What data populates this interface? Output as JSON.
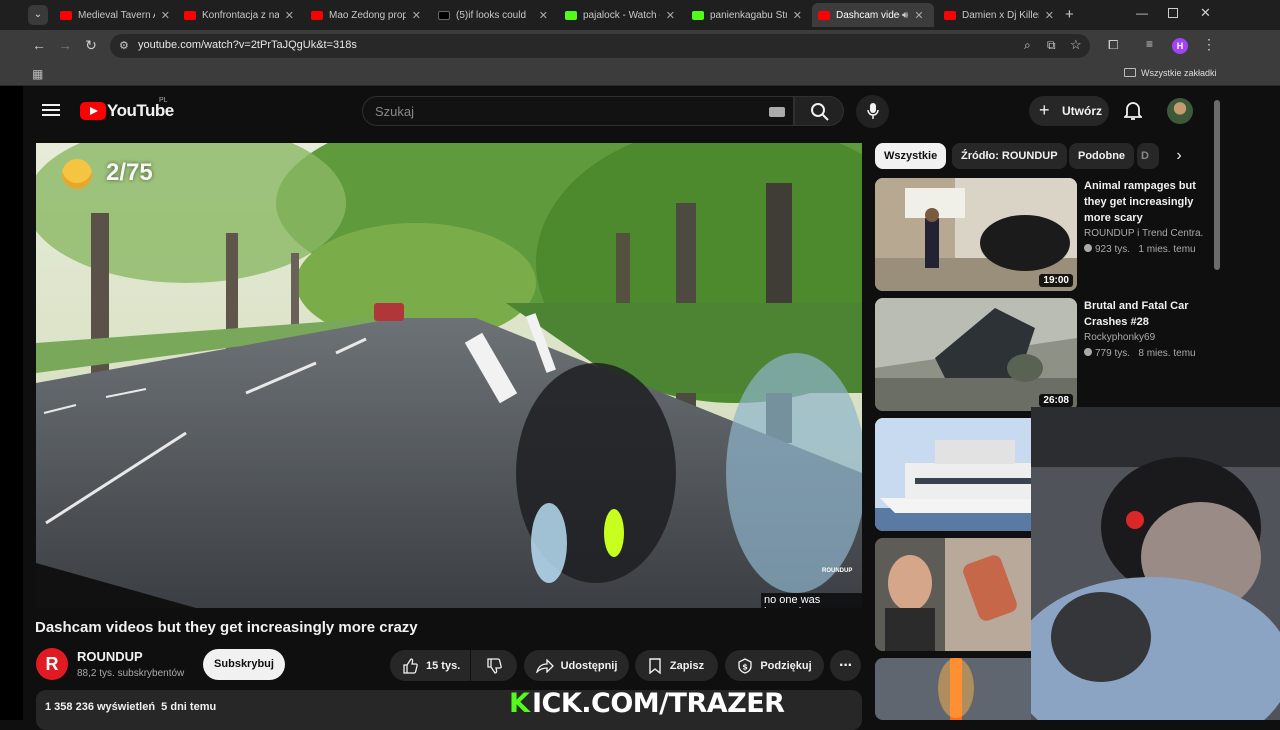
{
  "browser": {
    "tabs": [
      {
        "title": "Medieval Tavern Am",
        "fav": "#ff0000"
      },
      {
        "title": "Konfrontacja z nar",
        "fav": "#ff0000"
      },
      {
        "title": "Mao Zedong propo",
        "fav": "#ff0000"
      },
      {
        "title": "(5)if looks could",
        "fav": "#111111"
      },
      {
        "title": "pajalock - Watch cl",
        "fav": "#53fc18"
      },
      {
        "title": "panienkagabu Stre",
        "fav": "#53fc18"
      },
      {
        "title": "Dashcam video",
        "fav": "#ff0000"
      },
      {
        "title": "Damien x Dj Killer",
        "fav": "#ff0000"
      }
    ],
    "url": "youtube.com/watch?v=2tPrTaJQgUk&t=318s",
    "bookmarks_label": "Wszystkie zakładki",
    "profile_initial": "H"
  },
  "header": {
    "logo_text": "YouTube",
    "region": "PL",
    "search_placeholder": "Szukaj",
    "create_label": "Utwórz"
  },
  "video": {
    "counter": "2/75",
    "caption": "no one was harmed",
    "watermark": "ROUNDUP",
    "title": "Dashcam videos but they get increasingly more crazy"
  },
  "channel": {
    "avatar_letter": "R",
    "name": "ROUNDUP",
    "subs": "88,2 tys. subskrybentów",
    "subscribe_label": "Subskrybuj"
  },
  "actions": {
    "likes": "15 tys.",
    "share": "Udostępnij",
    "save": "Zapisz",
    "thanks": "Podziękuj"
  },
  "description": {
    "stats": "1 358 236 wyświetleń  5 dni temu"
  },
  "chips": [
    "Wszystkie",
    "Źródło: ROUNDUP",
    "Podobne",
    "D"
  ],
  "recommendations": [
    {
      "title": "Animal rampages but they get increasingly more scary",
      "channel": "ROUNDUP i Trend Centra...",
      "meta": "923 tys.   1 mies. temu",
      "duration": "19:00"
    },
    {
      "title": "Brutal and Fatal Car Crashes #28",
      "channel": "Rockyphonky69",
      "meta": "779 tys.   8 mies. temu",
      "duration": "26:08"
    }
  ],
  "overlay": {
    "kick_text": "ICK.COM/TRAZER",
    "kick_k": "K"
  },
  "colors": {
    "yt_red": "#ff0000",
    "kick_green": "#53fc18",
    "bg": "#0f0f0f"
  }
}
